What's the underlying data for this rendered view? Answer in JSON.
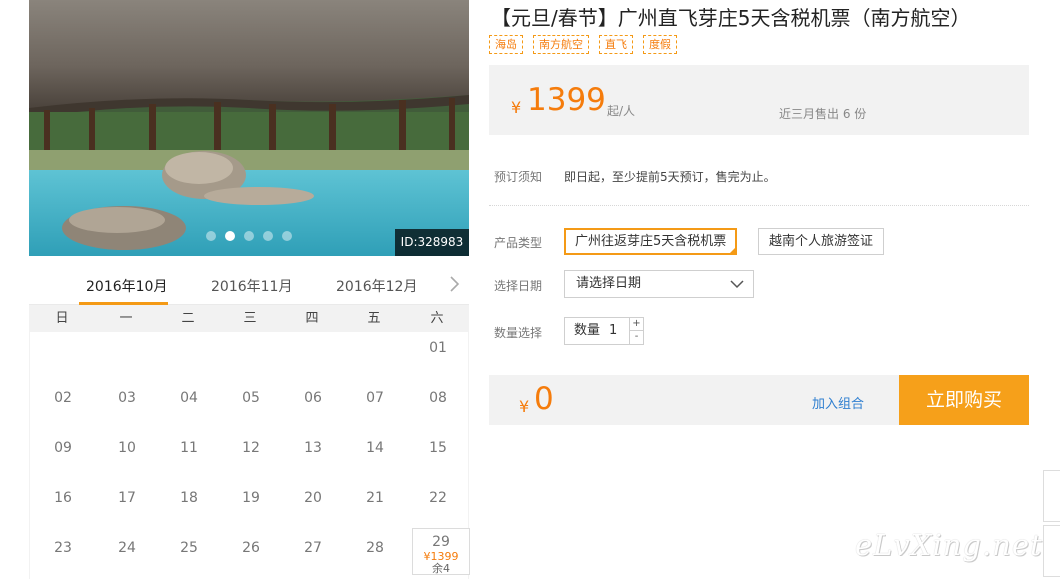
{
  "product": {
    "title": "【元旦/春节】广州直飞芽庄5天含税机票（南方航空）",
    "tags": [
      "海岛",
      "南方航空",
      "直飞",
      "度假"
    ],
    "currency_symbol": "¥",
    "price": "1399",
    "price_unit": "起/人",
    "sold_text": "近三月售出 6 份"
  },
  "booking": {
    "notice_label": "预订须知",
    "notice_text": "即日起，至少提前5天预订，售完为止。",
    "type_label": "产品类型",
    "type_options": [
      "广州往返芽庄5天含税机票",
      "越南个人旅游签证"
    ],
    "date_label": "选择日期",
    "date_placeholder": "请选择日期",
    "qty_label": "数量选择",
    "qty_field_label": "数量",
    "qty_value": "1",
    "qty_plus": "+",
    "qty_minus": "-"
  },
  "total": {
    "currency_symbol": "¥",
    "amount": "0",
    "add_combo": "加入组合",
    "buy_now": "立即购买"
  },
  "gallery": {
    "id_label": "ID:328983",
    "dot_count": 5,
    "active_dot": 1
  },
  "calendar": {
    "months": [
      "2016年10月",
      "2016年11月",
      "2016年12月"
    ],
    "active_month": 0,
    "weekdays": [
      "日",
      "一",
      "二",
      "三",
      "四",
      "五",
      "六"
    ],
    "rows": [
      [
        "",
        "",
        "",
        "",
        "",
        "",
        "01"
      ],
      [
        "02",
        "03",
        "04",
        "05",
        "06",
        "07",
        "08"
      ],
      [
        "09",
        "10",
        "11",
        "12",
        "13",
        "14",
        "15"
      ],
      [
        "16",
        "17",
        "18",
        "19",
        "20",
        "21",
        "22"
      ],
      [
        "23",
        "24",
        "25",
        "26",
        "27",
        "28",
        "29"
      ]
    ],
    "special_day": {
      "day": "29",
      "price": "¥1399",
      "remaining": "余4"
    }
  },
  "watermark": "eLvXing.net",
  "colors": {
    "accent": "#f49a16",
    "price": "#f57c0c",
    "link": "#2f7fd0",
    "panel": "#f2f2f2"
  }
}
